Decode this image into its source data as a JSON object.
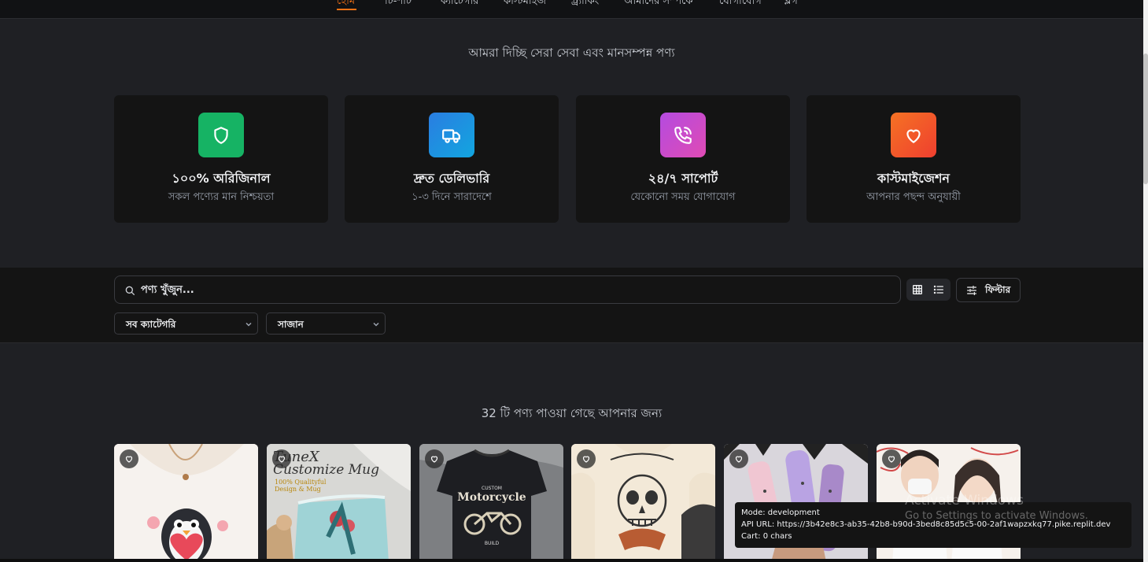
{
  "nav": {
    "items": [
      {
        "label": "হোম",
        "active": true
      },
      {
        "label": "টি-শার্ট",
        "active": false
      },
      {
        "label": "ক্যাটেগরি",
        "active": false
      },
      {
        "label": "কাস্টমাইজ",
        "active": false
      },
      {
        "label": "ট্র্যাকিং",
        "active": false
      },
      {
        "label": "আমাদের সম্পর্কে",
        "active": false
      },
      {
        "label": "যোগাযোগ",
        "active": false
      },
      {
        "label": "ব্লগ",
        "active": false
      }
    ]
  },
  "tagline": "আমরা দিচ্ছি সেরা সেবা এবং মানসম্পন্ন পণ্য",
  "features": [
    {
      "title": "১০০% অরিজিনাল",
      "subtitle": "সকল পণ্যের মান নিশ্চয়তা",
      "icon": "shield-icon",
      "color": "#16b364"
    },
    {
      "title": "দ্রুত ডেলিভারি",
      "subtitle": "১-৩ দিনে সারাদেশে",
      "icon": "truck-icon",
      "color": "#1e90e8"
    },
    {
      "title": "২৪/৭ সাপোর্ট",
      "subtitle": "যেকোনো সময় যোগাযোগ",
      "icon": "phone-call-icon",
      "color": "#c044d8"
    },
    {
      "title": "কাস্টমাইজেশন",
      "subtitle": "আপনার পছন্দ অনুযায়ী",
      "icon": "heart-icon",
      "color": "#f25a22"
    }
  ],
  "search": {
    "placeholder": "পণ্য খুঁজুন..."
  },
  "filter_button": "ফিল্টার",
  "category_select": "সব ক্যাটেগরি",
  "sort_select": "সাজান",
  "result_count": "32 টি পণ্য পাওয়া গেছে আপনার জন্য",
  "products": [
    {
      "name": "penguin-tshirt"
    },
    {
      "name": "customize-mug",
      "text1": "TuneX",
      "text2": "Customize Mug",
      "text3": "100% Qualityful",
      "text4": "Design & Mug"
    },
    {
      "name": "motorcycle-tshirt",
      "text1": "CUSTOM",
      "text2": "Motorcycle",
      "text3": "BUILD"
    },
    {
      "name": "skull-tshirt"
    },
    {
      "name": "water-bottles"
    },
    {
      "name": "couple-tshirt"
    }
  ],
  "dev_panel": {
    "mode": "Mode: development",
    "api_url": "API URL: https://3b42e8c3-ab35-42b8-b90d-3bed8c85d5c5-00-2af1wapzxkq77.pike.replit.dev",
    "cart": "Cart: 0 chars"
  },
  "watermark": {
    "line1": "Activate Windows",
    "line2": "Go to Settings to activate Windows."
  }
}
